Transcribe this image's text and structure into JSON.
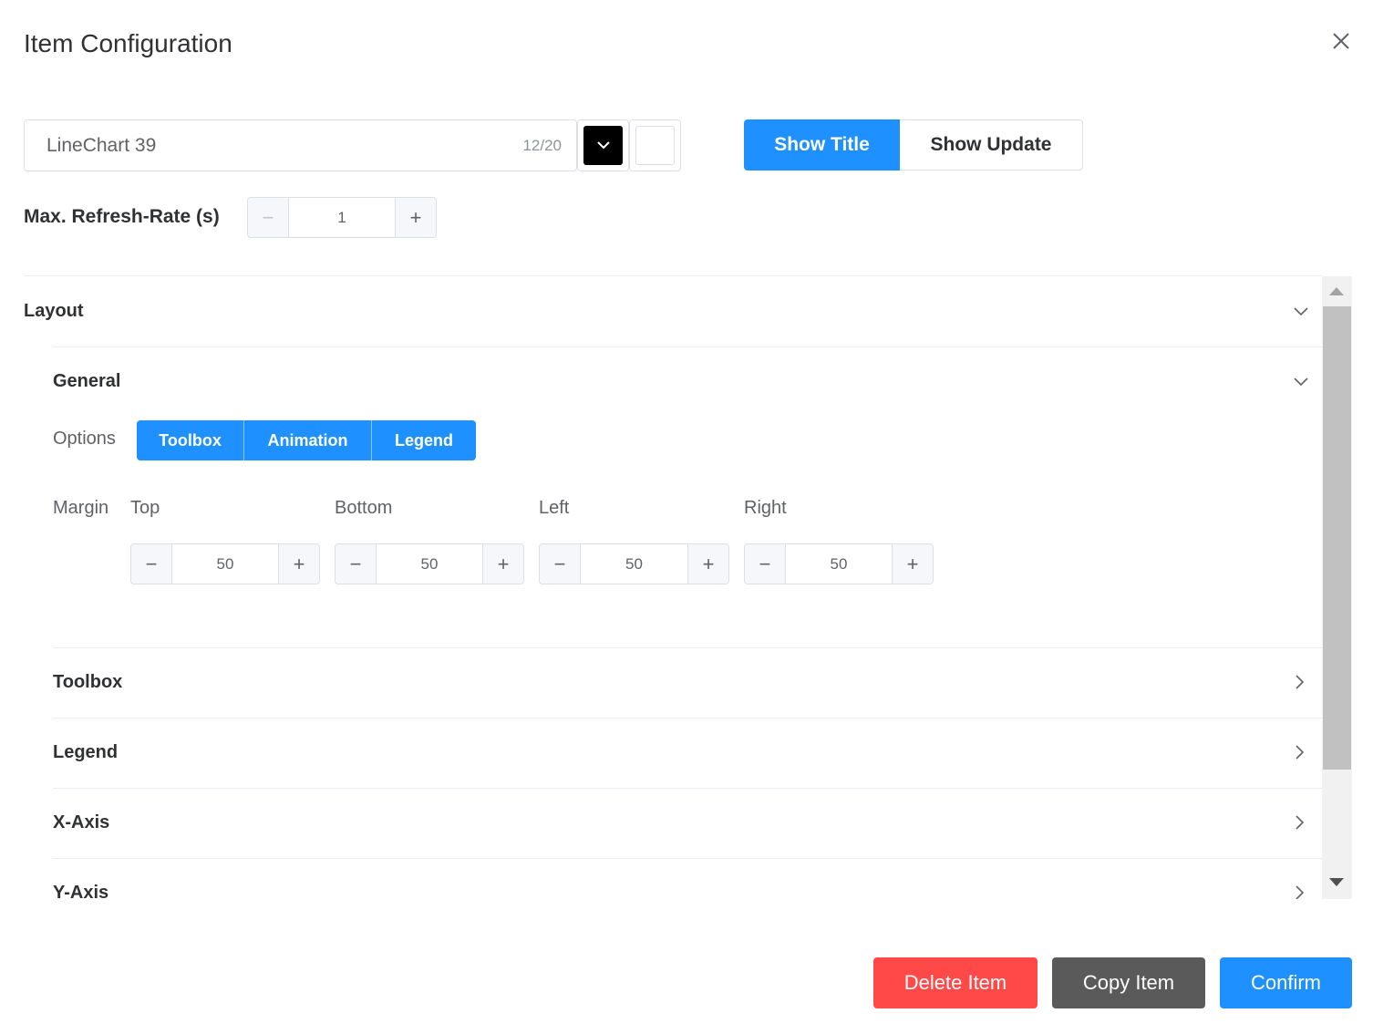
{
  "dialog": {
    "title": "Item Configuration"
  },
  "name": {
    "value": "LineChart 39",
    "count": "12/20"
  },
  "colors": {
    "title_color": "#000000",
    "background_color": "#ffffff",
    "accent": "#1e90ff",
    "danger": "#ff4949",
    "neutral": "#5a5a5a"
  },
  "title_toggle": {
    "show_title": "Show Title",
    "show_update": "Show Update",
    "selected": "Show Title"
  },
  "refresh": {
    "label": "Max. Refresh-Rate (s)",
    "value": "1"
  },
  "layout": {
    "title": "Layout",
    "general": {
      "title": "General",
      "options_label": "Options",
      "options": [
        "Toolbox",
        "Animation",
        "Legend"
      ],
      "margin": {
        "label": "Margin",
        "top": {
          "label": "Top",
          "value": "50"
        },
        "bottom": {
          "label": "Bottom",
          "value": "50"
        },
        "left": {
          "label": "Left",
          "value": "50"
        },
        "right": {
          "label": "Right",
          "value": "50"
        }
      }
    },
    "sections": [
      "Toolbox",
      "Legend",
      "X-Axis",
      "Y-Axis"
    ]
  },
  "footer": {
    "delete": "Delete Item",
    "copy": "Copy Item",
    "confirm": "Confirm"
  }
}
